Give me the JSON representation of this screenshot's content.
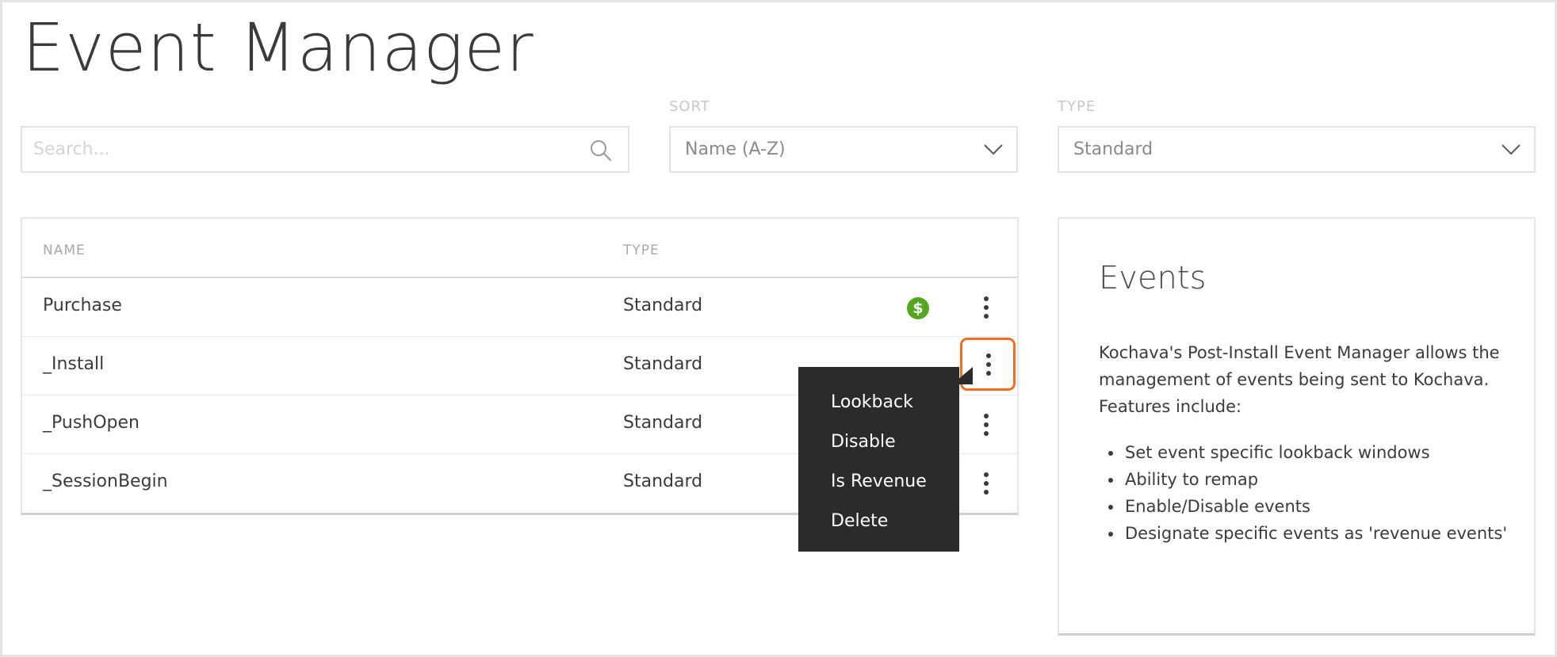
{
  "page": {
    "title": "Event Manager"
  },
  "filters": {
    "search_placeholder": "Search...",
    "sort_label": "SORT",
    "sort_value": "Name (A-Z)",
    "type_label": "TYPE",
    "type_value": "Standard"
  },
  "table": {
    "headers": {
      "name": "NAME",
      "type": "TYPE"
    },
    "rows": [
      {
        "name": "Purchase",
        "type": "Standard",
        "revenue": true
      },
      {
        "name": "_Install",
        "type": "Standard",
        "revenue": false
      },
      {
        "name": "_PushOpen",
        "type": "Standard",
        "revenue": false
      },
      {
        "name": "_SessionBegin",
        "type": "Standard",
        "revenue": false
      }
    ],
    "revenue_symbol": "$"
  },
  "context_menu": {
    "items": [
      "Lookback",
      "Disable",
      "Is Revenue",
      "Delete"
    ]
  },
  "info_panel": {
    "title": "Events",
    "description": "Kochava's Post-Install Event Manager allows the management of events being sent to Kochava. Features include:",
    "features": [
      "Set event specific lookback windows",
      "Ability to remap",
      "Enable/Disable events",
      "Designate specific events as 'revenue events'"
    ]
  },
  "colors": {
    "highlight": "#f26f21",
    "revenue_badge": "#55a621",
    "menu_background": "#2b2b2b"
  }
}
